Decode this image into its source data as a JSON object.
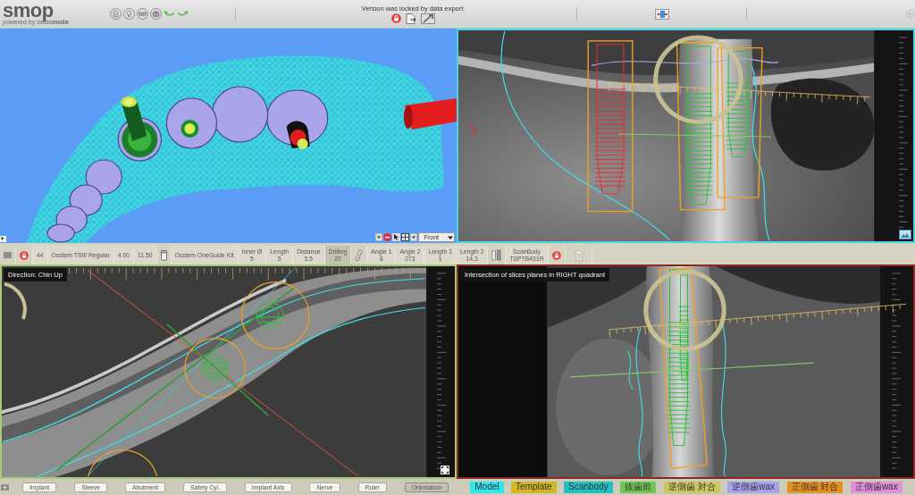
{
  "toolbar": {
    "logo": "smop",
    "tagline": "powered by swiss**meda**",
    "status": "Version was locked by data export.",
    "locked": true
  },
  "viewports": [
    {
      "kind": "model3d",
      "view": "Front"
    },
    {
      "kind": "cross-section",
      "color": "#4fd2e4"
    },
    {
      "kind": "axial",
      "color": "#a9c97a",
      "caption": "Direction: Chin Up"
    },
    {
      "kind": "tangential",
      "color": "#8a2a24",
      "caption": "Intersection of slices planes in RIGHT quadrant"
    }
  ],
  "implant_bar": {
    "locked": true,
    "tooth": "44",
    "implant": "Osstem TSIII Regular",
    "diameter": "4.00",
    "length": "11.50",
    "guide_kit": "Osstem OneGuide Kit",
    "sleeve_params": [
      {
        "label": "Inner Ø",
        "value": "5",
        "highlighted": false
      },
      {
        "label": "Length",
        "value": "5",
        "highlighted": false
      },
      {
        "label": "Distance",
        "value": "5.5",
        "highlighted": false
      },
      {
        "label": "Drilling",
        "value": "22",
        "highlighted": true
      }
    ],
    "angle_params": [
      {
        "label": "Angle 1",
        "value": "8",
        "highlighted": false
      },
      {
        "label": "Angle 2",
        "value": "273",
        "highlighted": false
      },
      {
        "label": "Length 1",
        "value": "1",
        "highlighted": false
      },
      {
        "label": "Length 2",
        "value": "14.3",
        "highlighted": false
      }
    ],
    "scanbody": {
      "label": "ScanBody",
      "value": "TSPTB431R",
      "locked": true
    }
  },
  "display_toggles": [
    {
      "label": "Implant",
      "selected": false
    },
    {
      "label": "Sleeve",
      "selected": false
    },
    {
      "label": "Abutment",
      "selected": false
    },
    {
      "label": "Safety Cyl.",
      "selected": false
    },
    {
      "label": "Implant Axis",
      "selected": false
    },
    {
      "label": "Nerve",
      "selected": false
    },
    {
      "label": "Ruler",
      "selected": false
    },
    {
      "label": "Orientation",
      "selected": true
    }
  ],
  "model_layers": [
    {
      "label": "Model",
      "color": "#2ee6ee"
    },
    {
      "label": "Template",
      "color": "#d2b624"
    },
    {
      "label": "Scanbody",
      "color": "#22c0c2"
    },
    {
      "label": "抜歯前",
      "color": "#6fc653"
    },
    {
      "label": "逆側歯 対合",
      "color": "#cbc75e"
    },
    {
      "label": "逆側歯wax",
      "color": "#a7a1ef"
    },
    {
      "label": "正側歯 対合",
      "color": "#e6901f"
    },
    {
      "label": "正側歯wax",
      "color": "#df8fdc"
    }
  ]
}
